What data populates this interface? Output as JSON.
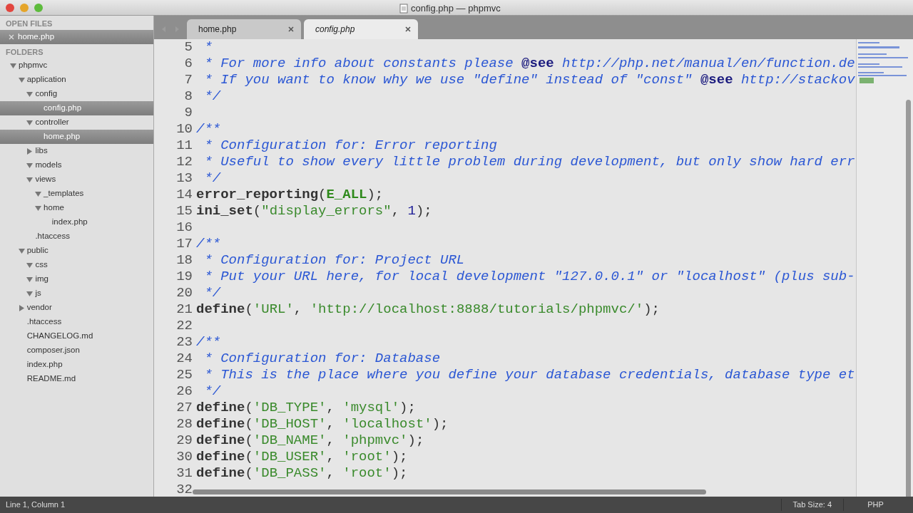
{
  "window": {
    "title": "config.php — phpmvc"
  },
  "sidebar": {
    "open_files_heading": "OPEN FILES",
    "open_files": [
      {
        "label": "home.php",
        "selected": true
      }
    ],
    "folders_heading": "FOLDERS",
    "tree": [
      {
        "label": "phpmvc",
        "expanded": true,
        "selected": false,
        "children": [
          {
            "label": "application",
            "expanded": true,
            "selected": false,
            "children": [
              {
                "label": "config",
                "expanded": true,
                "selected": false,
                "children": [
                  {
                    "label": "config.php",
                    "selected": true
                  }
                ]
              },
              {
                "label": "controller",
                "expanded": true,
                "selected": false,
                "children": [
                  {
                    "label": "home.php",
                    "selected": true
                  }
                ]
              },
              {
                "label": "libs",
                "expanded": false,
                "selected": false
              },
              {
                "label": "models",
                "expanded": true,
                "selected": false
              },
              {
                "label": "views",
                "expanded": true,
                "selected": false,
                "children": [
                  {
                    "label": "_templates",
                    "expanded": true,
                    "selected": false
                  },
                  {
                    "label": "home",
                    "expanded": true,
                    "selected": false,
                    "children": [
                      {
                        "label": "index.php",
                        "selected": false
                      }
                    ]
                  }
                ]
              },
              {
                "label": ".htaccess",
                "selected": false
              }
            ]
          },
          {
            "label": "public",
            "expanded": true,
            "selected": false,
            "children": [
              {
                "label": "css",
                "expanded": true,
                "selected": false
              },
              {
                "label": "img",
                "expanded": true,
                "selected": false
              },
              {
                "label": "js",
                "expanded": true,
                "selected": false
              }
            ]
          },
          {
            "label": "vendor",
            "expanded": false,
            "selected": false
          },
          {
            "label": ".htaccess",
            "selected": false
          },
          {
            "label": "CHANGELOG.md",
            "selected": false
          },
          {
            "label": "composer.json",
            "selected": false
          },
          {
            "label": "index.php",
            "selected": false
          },
          {
            "label": "README.md",
            "selected": false
          }
        ]
      }
    ]
  },
  "tabs": [
    {
      "label": "home.php",
      "selected": false
    },
    {
      "label": "config.php",
      "selected": true
    }
  ],
  "code": [
    {
      "number": "5",
      "tokens": [
        {
          "kind": "comment",
          "text": " *"
        }
      ]
    },
    {
      "number": "6",
      "tokens": [
        {
          "kind": "comment",
          "text": " * For more info about constants please "
        },
        {
          "kind": "tag",
          "text": "@see"
        },
        {
          "kind": "comment",
          "text": " http://php.net/manual/en/function.de"
        }
      ]
    },
    {
      "number": "7",
      "tokens": [
        {
          "kind": "comment",
          "text": " * If you want to know why we use \"define\" instead of \"const\" "
        },
        {
          "kind": "tag",
          "text": "@see"
        },
        {
          "kind": "comment",
          "text": " http://stackov"
        }
      ]
    },
    {
      "number": "8",
      "tokens": [
        {
          "kind": "comment",
          "text": " */"
        }
      ]
    },
    {
      "number": "9"
    },
    {
      "number": "10",
      "tokens": [
        {
          "kind": "comment",
          "text": "/**"
        }
      ]
    },
    {
      "number": "11",
      "tokens": [
        {
          "kind": "comment",
          "text": " * Configuration for: Error reporting"
        }
      ]
    },
    {
      "number": "12",
      "tokens": [
        {
          "kind": "comment",
          "text": " * Useful to show every little problem during development, but only show hard err"
        }
      ]
    },
    {
      "number": "13",
      "tokens": [
        {
          "kind": "comment",
          "text": " */"
        }
      ]
    },
    {
      "number": "14",
      "tokens": [
        {
          "kind": "func",
          "text": "error_reporting"
        },
        {
          "kind": "plain",
          "text": "("
        },
        {
          "kind": "const",
          "text": "E_ALL"
        },
        {
          "kind": "plain",
          "text": ");"
        }
      ]
    },
    {
      "number": "15",
      "tokens": [
        {
          "kind": "func",
          "text": "ini_set"
        },
        {
          "kind": "plain",
          "text": "("
        },
        {
          "kind": "string",
          "text": "\"display_errors\""
        },
        {
          "kind": "plain",
          "text": ", "
        },
        {
          "kind": "number",
          "text": "1"
        },
        {
          "kind": "plain",
          "text": ");"
        }
      ]
    },
    {
      "number": "16"
    },
    {
      "number": "17",
      "tokens": [
        {
          "kind": "comment",
          "text": "/**"
        }
      ]
    },
    {
      "number": "18",
      "tokens": [
        {
          "kind": "comment",
          "text": " * Configuration for: Project URL"
        }
      ]
    },
    {
      "number": "19",
      "tokens": [
        {
          "kind": "comment",
          "text": " * Put your URL here, for local development \"127.0.0.1\" or \"localhost\" (plus sub-"
        }
      ]
    },
    {
      "number": "20",
      "tokens": [
        {
          "kind": "comment",
          "text": " */"
        }
      ]
    },
    {
      "number": "21",
      "tokens": [
        {
          "kind": "func",
          "text": "define"
        },
        {
          "kind": "plain",
          "text": "("
        },
        {
          "kind": "string",
          "text": "'URL'"
        },
        {
          "kind": "plain",
          "text": ", "
        },
        {
          "kind": "string",
          "text": "'http://localhost:8888/tutorials/phpmvc/'"
        },
        {
          "kind": "plain",
          "text": ");"
        }
      ]
    },
    {
      "number": "22"
    },
    {
      "number": "23",
      "tokens": [
        {
          "kind": "comment",
          "text": "/**"
        }
      ]
    },
    {
      "number": "24",
      "tokens": [
        {
          "kind": "comment",
          "text": " * Configuration for: Database"
        }
      ]
    },
    {
      "number": "25",
      "tokens": [
        {
          "kind": "comment",
          "text": " * This is the place where you define your database credentials, database type et"
        }
      ]
    },
    {
      "number": "26",
      "tokens": [
        {
          "kind": "comment",
          "text": " */"
        }
      ]
    },
    {
      "number": "27",
      "tokens": [
        {
          "kind": "func",
          "text": "define"
        },
        {
          "kind": "plain",
          "text": "("
        },
        {
          "kind": "string",
          "text": "'DB_TYPE'"
        },
        {
          "kind": "plain",
          "text": ", "
        },
        {
          "kind": "string",
          "text": "'mysql'"
        },
        {
          "kind": "plain",
          "text": ");"
        }
      ]
    },
    {
      "number": "28",
      "tokens": [
        {
          "kind": "func",
          "text": "define"
        },
        {
          "kind": "plain",
          "text": "("
        },
        {
          "kind": "string",
          "text": "'DB_HOST'"
        },
        {
          "kind": "plain",
          "text": ", "
        },
        {
          "kind": "string",
          "text": "'localhost'"
        },
        {
          "kind": "plain",
          "text": ");"
        }
      ]
    },
    {
      "number": "29",
      "tokens": [
        {
          "kind": "func",
          "text": "define"
        },
        {
          "kind": "plain",
          "text": "("
        },
        {
          "kind": "string",
          "text": "'DB_NAME'"
        },
        {
          "kind": "plain",
          "text": ", "
        },
        {
          "kind": "string",
          "text": "'phpmvc'"
        },
        {
          "kind": "plain",
          "text": ");"
        }
      ]
    },
    {
      "number": "30",
      "tokens": [
        {
          "kind": "func",
          "text": "define"
        },
        {
          "kind": "plain",
          "text": "("
        },
        {
          "kind": "string",
          "text": "'DB_USER'"
        },
        {
          "kind": "plain",
          "text": ", "
        },
        {
          "kind": "string",
          "text": "'root'"
        },
        {
          "kind": "plain",
          "text": ");"
        }
      ]
    },
    {
      "number": "31",
      "tokens": [
        {
          "kind": "func",
          "text": "define"
        },
        {
          "kind": "plain",
          "text": "("
        },
        {
          "kind": "string",
          "text": "'DB_PASS'"
        },
        {
          "kind": "plain",
          "text": ", "
        },
        {
          "kind": "string",
          "text": "'root'"
        },
        {
          "kind": "plain",
          "text": ");"
        }
      ]
    },
    {
      "number": "32"
    }
  ],
  "status_bar": {
    "position": "Line 1, Column 1",
    "tab_size": "Tab Size: 4",
    "syntax": "PHP"
  }
}
